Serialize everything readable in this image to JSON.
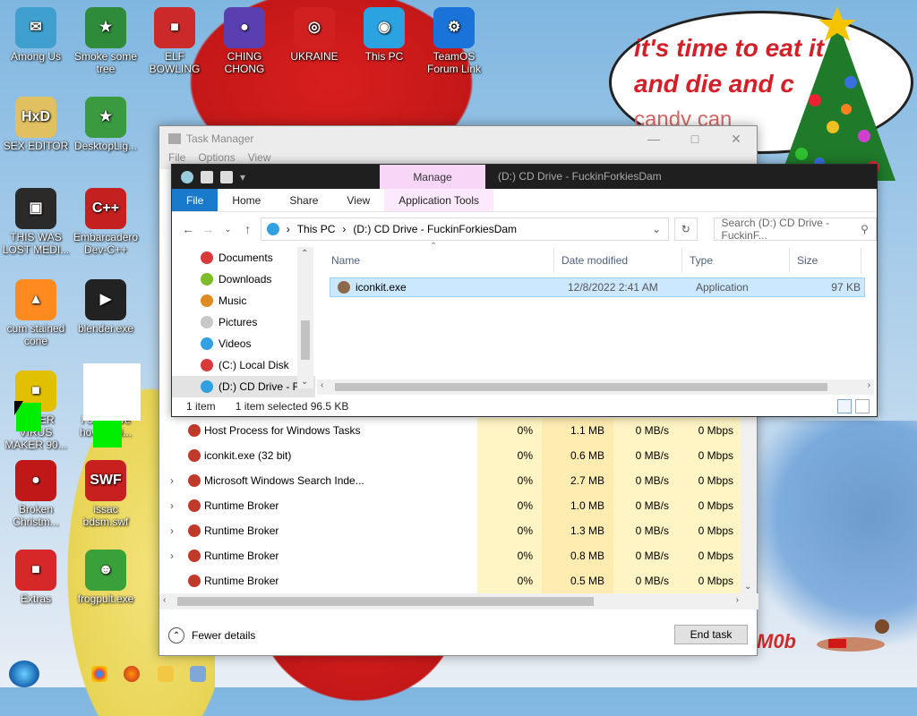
{
  "wallpaper": {
    "speech_line1": "it's time to eat it",
    "speech_line2": "and die and c",
    "speech_line3": "candy can",
    "signature": "M0b"
  },
  "desktop_icons": [
    {
      "label": "Among Us",
      "color": "#3fa0d0",
      "glyph": "✉"
    },
    {
      "label": "Smoke some tree",
      "color": "#2e8b3a",
      "glyph": "★"
    },
    {
      "label": "ELF BOWLING",
      "color": "#cc2a2a",
      "glyph": "■"
    },
    {
      "label": "CHING CHONG",
      "color": "#5a3fb0",
      "glyph": "●"
    },
    {
      "label": "UKRAINE",
      "color": "#d02020",
      "glyph": "◎"
    },
    {
      "label": "This PC",
      "color": "#2aa3e0",
      "glyph": "◉"
    },
    {
      "label": "TeamOS Forum Link",
      "color": "#1a73d9",
      "glyph": "⚙"
    },
    {
      "label": "SEX EDITOR",
      "color": "#e0c060",
      "glyph": "HxD"
    },
    {
      "label": "DesktopLig...",
      "color": "#3a9a40",
      "glyph": "★"
    },
    {
      "label": "THIS WAS LOST MEDI...",
      "color": "#2a2a2a",
      "glyph": "▣"
    },
    {
      "label": "Embarcadero Dev-C++",
      "color": "#c42020",
      "glyph": "C++"
    },
    {
      "label": "cum stained cone",
      "color": "#ff8a20",
      "glyph": "▲"
    },
    {
      "label": "blender.exe",
      "color": "#222",
      "glyph": "▶"
    },
    {
      "label": "SUPER VIRUS MAKER 90...",
      "color": "#e0c000",
      "glyph": "■"
    },
    {
      "label": "I can have how to di...",
      "color": "#ffffff",
      "glyph": ""
    },
    {
      "label": "Broken Christm...",
      "color": "#c01818",
      "glyph": "●"
    },
    {
      "label": "issac bdsm.swf",
      "color": "#c81f1f",
      "glyph": "SWF"
    },
    {
      "label": "Extras",
      "color": "#d62828",
      "glyph": "■"
    },
    {
      "label": "frogpult.exe",
      "color": "#3aa03a",
      "glyph": "☻"
    }
  ],
  "task_manager": {
    "title": "Task Manager",
    "menu": [
      "File",
      "Options",
      "View"
    ],
    "rows": [
      {
        "name": "Host Process for Windows Tasks",
        "expand": "",
        "cpu": "0%",
        "mem": "1.1 MB",
        "disk": "0 MB/s",
        "net": "0 Mbps"
      },
      {
        "name": "iconkit.exe (32 bit)",
        "expand": "",
        "cpu": "0%",
        "mem": "0.6 MB",
        "disk": "0 MB/s",
        "net": "0 Mbps"
      },
      {
        "name": "Microsoft Windows Search Inde...",
        "expand": "›",
        "cpu": "0%",
        "mem": "2.7 MB",
        "disk": "0 MB/s",
        "net": "0 Mbps"
      },
      {
        "name": "Runtime Broker",
        "expand": "›",
        "cpu": "0%",
        "mem": "1.0 MB",
        "disk": "0 MB/s",
        "net": "0 Mbps"
      },
      {
        "name": "Runtime Broker",
        "expand": "›",
        "cpu": "0%",
        "mem": "1.3 MB",
        "disk": "0 MB/s",
        "net": "0 Mbps"
      },
      {
        "name": "Runtime Broker",
        "expand": "›",
        "cpu": "0%",
        "mem": "0.8 MB",
        "disk": "0 MB/s",
        "net": "0 Mbps"
      },
      {
        "name": "Runtime Broker",
        "expand": "",
        "cpu": "0%",
        "mem": "0.5 MB",
        "disk": "0 MB/s",
        "net": "0 Mbps"
      }
    ],
    "fewer_details": "Fewer details",
    "end_task": "End task"
  },
  "explorer": {
    "manage_tab": "Manage",
    "title_path": "(D:) CD Drive - FuckinForkiesDam",
    "tabs": [
      "File",
      "Home",
      "Share",
      "View",
      "Application Tools"
    ],
    "address": {
      "root": "This PC",
      "location": "(D:) CD Drive - FuckinForkiesDam"
    },
    "search_placeholder": "Search (D:) CD Drive - FuckinF...",
    "nav_items": [
      {
        "label": "Documents",
        "color": "#d83a3a"
      },
      {
        "label": "Downloads",
        "color": "#7dbd2a"
      },
      {
        "label": "Music",
        "color": "#e08a20"
      },
      {
        "label": "Pictures",
        "color": "#c8c8c8"
      },
      {
        "label": "Videos",
        "color": "#30a0e0"
      },
      {
        "label": "(C:) Local Disk",
        "color": "#d83a3a"
      },
      {
        "label": "(D:) CD Drive - F",
        "color": "#30a0e0"
      }
    ],
    "columns": [
      "Name",
      "Date modified",
      "Type",
      "Size"
    ],
    "files": [
      {
        "name": "iconkit.exe",
        "date": "12/8/2022 2:41 AM",
        "type": "Application",
        "size": "97 KB"
      }
    ],
    "status": {
      "count": "1 item",
      "selected": "1 item selected 96.5 KB"
    }
  }
}
